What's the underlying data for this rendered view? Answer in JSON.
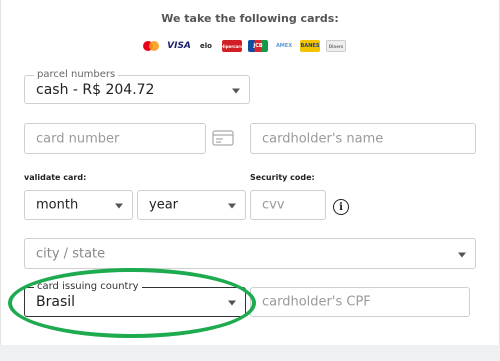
{
  "cards_section": {
    "title": "We take the following cards:",
    "brands": [
      {
        "name": "mastercard-icon",
        "text": ""
      },
      {
        "name": "visa-icon",
        "text": "VISA"
      },
      {
        "name": "elo-icon",
        "text": "elo"
      },
      {
        "name": "hipercard-icon",
        "text": "Hipercard"
      },
      {
        "name": "jcb-icon",
        "text": "JCB"
      },
      {
        "name": "amex-icon",
        "text": "AMEX"
      },
      {
        "name": "banescard-icon",
        "text": "BANES"
      },
      {
        "name": "diners-icon",
        "text": "Diners"
      }
    ]
  },
  "installments": {
    "legend": "parcel numbers",
    "value": "cash - R$ 204.72"
  },
  "card_number": {
    "placeholder": "card number",
    "icon": "credit-card-icon"
  },
  "cardholder_name": {
    "placeholder": "cardholder's name"
  },
  "validity": {
    "label": "validate card:",
    "month_value": "month",
    "year_value": "year"
  },
  "security": {
    "label": "Security code:",
    "placeholder": "cvv",
    "info_icon": "info-icon",
    "info_glyph": "i"
  },
  "city_state": {
    "placeholder": "city / state"
  },
  "issuing_country": {
    "legend": "card issuing country",
    "value": "Brasil"
  },
  "cpf": {
    "placeholder": "cardholder's CPF"
  },
  "colors": {
    "highlight": "#1eaa4f",
    "border": "#cfcfcf",
    "placeholder": "#9a9a9a"
  }
}
